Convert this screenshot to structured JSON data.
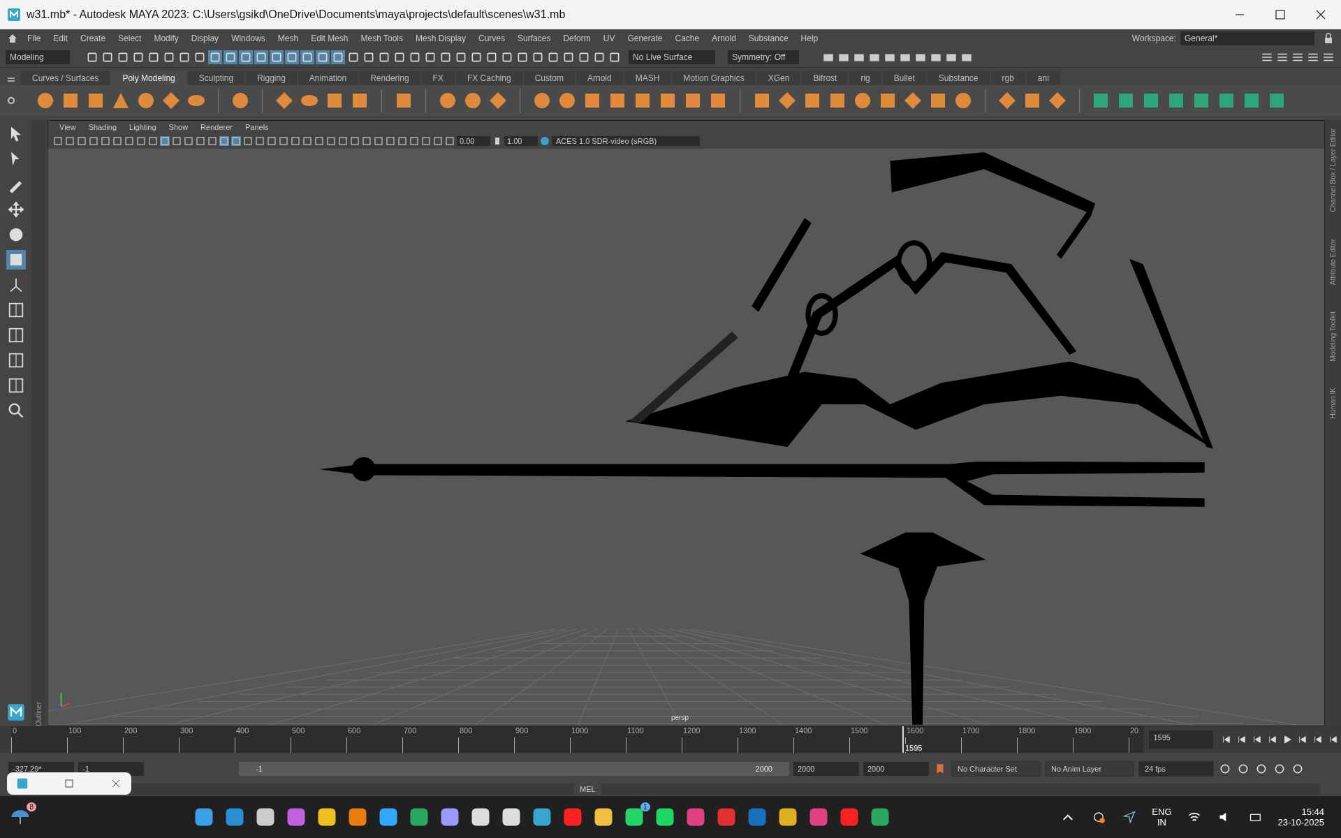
{
  "window": {
    "title": "w31.mb* - Autodesk MAYA 2023: C:\\Users\\gsikd\\OneDrive\\Documents\\maya\\projects\\default\\scenes\\w31.mb"
  },
  "menu_bar": [
    "File",
    "Edit",
    "Create",
    "Select",
    "Modify",
    "Display",
    "Windows",
    "Mesh",
    "Edit Mesh",
    "Mesh Tools",
    "Mesh Display",
    "Curves",
    "Surfaces",
    "Deform",
    "UV",
    "Generate",
    "Cache",
    "Arnold",
    "Substance",
    "Help"
  ],
  "workspace": {
    "label": "Workspace:",
    "value": "General*"
  },
  "status_line": {
    "mode": "Modeling",
    "live_surface": "No Live Surface",
    "symmetry": "Symmetry: Off"
  },
  "shelf_tabs": [
    {
      "label": "Curves / Surfaces",
      "selected": false
    },
    {
      "label": "Poly Modeling",
      "selected": true
    },
    {
      "label": "Sculpting",
      "selected": false
    },
    {
      "label": "Rigging",
      "selected": false
    },
    {
      "label": "Animation",
      "selected": false
    },
    {
      "label": "Rendering",
      "selected": false
    },
    {
      "label": "FX",
      "selected": false
    },
    {
      "label": "FX Caching",
      "selected": false
    },
    {
      "label": "Custom",
      "selected": false
    },
    {
      "label": "Arnold",
      "selected": false
    },
    {
      "label": "MASH",
      "selected": false
    },
    {
      "label": "Motion Graphics",
      "selected": false
    },
    {
      "label": "XGen",
      "selected": false
    },
    {
      "label": "Bifrost",
      "selected": false
    },
    {
      "label": "rig",
      "selected": false
    },
    {
      "label": "Bullet",
      "selected": false
    },
    {
      "label": "Substance",
      "selected": false
    },
    {
      "label": "rgb",
      "selected": false
    },
    {
      "label": "ani",
      "selected": false
    }
  ],
  "toolbox": [
    {
      "kind": "select",
      "selected": false
    },
    {
      "kind": "lasso",
      "selected": false
    },
    {
      "kind": "paint",
      "selected": false
    },
    {
      "kind": "move",
      "selected": false
    },
    {
      "kind": "rotate",
      "selected": false
    },
    {
      "kind": "scale",
      "selected": true
    }
  ],
  "outliner_tab": "Outliner",
  "viewport": {
    "menus": [
      "View",
      "Shading",
      "Lighting",
      "Show",
      "Renderer",
      "Panels"
    ],
    "exposure": "0.00",
    "gamma": "1.00",
    "color_space": "ACES 1.0 SDR-video (sRGB)",
    "camera": "persp"
  },
  "side_tabs": [
    "Channel Box / Layer Editor",
    "Attribute Editor",
    "Modeling Toolkit",
    "Human IK"
  ],
  "timeline": {
    "ticks": [
      "0",
      "100",
      "200",
      "300",
      "400",
      "500",
      "600",
      "700",
      "800",
      "900",
      "1000",
      "1100",
      "1200",
      "1300",
      "1400",
      "1500",
      "1600",
      "1700",
      "1800",
      "1900",
      "20"
    ],
    "current_frame": "1595",
    "level": 0.7975,
    "frame_field": "1595"
  },
  "range": {
    "start": "-327.29*",
    "current": "-1",
    "slider_start": "-1",
    "slider_end": "2000",
    "level": 1,
    "end": "2000",
    "scene_end": "2000",
    "character_set": "No Character Set",
    "anim_layer": "No Anim Layer",
    "fps": "24 fps"
  },
  "command_line": {
    "label": "MEL"
  },
  "taskbar": {
    "weather_badge": "8",
    "whatsapp_badge": "1",
    "language": "ENG",
    "region": "IN",
    "time": "15:44",
    "date": "23-10-2025"
  }
}
